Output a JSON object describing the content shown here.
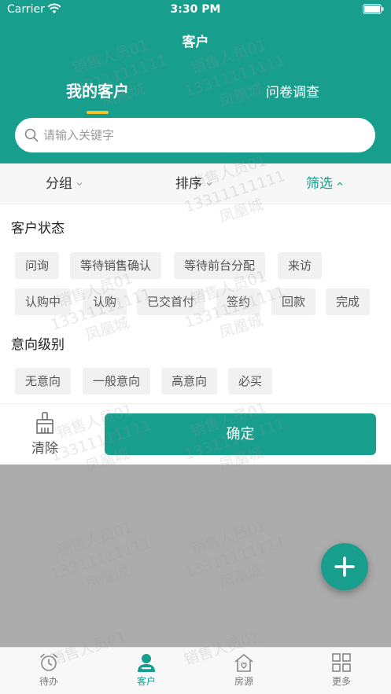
{
  "status_bar": {
    "carrier": "Carrier",
    "time": "3:30 PM"
  },
  "nav": {
    "title": "客户"
  },
  "top_tabs": {
    "mine": "我的客户",
    "survey": "问卷调查"
  },
  "search": {
    "placeholder": "请输入关键字"
  },
  "filter_bar": {
    "group": "分组",
    "sort": "排序",
    "filter": "筛选"
  },
  "customer_status": {
    "title": "客户状态",
    "chips": [
      "问询",
      "等待销售确认",
      "等待前台分配",
      "来访",
      "认购中",
      "认购",
      "已交首付",
      "签约",
      "回款",
      "完成"
    ]
  },
  "intent_level": {
    "title": "意向级别",
    "chips": [
      "无意向",
      "一般意向",
      "高意向",
      "必买"
    ]
  },
  "actions": {
    "clear": "清除",
    "confirm": "确定"
  },
  "tabbar": {
    "todo": "待办",
    "customer": "客户",
    "listing": "房源",
    "more": "更多"
  },
  "watermark": {
    "line1": "销售人员01",
    "line2": "13311111111",
    "line3": "凤凰城"
  },
  "colors": {
    "primary": "#189e8d",
    "indicator": "#f4c22b"
  }
}
